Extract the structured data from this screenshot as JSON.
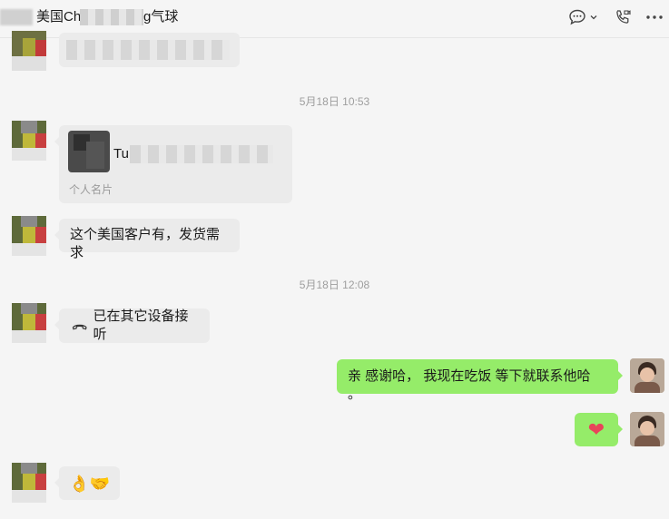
{
  "header": {
    "title_prefix": "美国Chri",
    "title_suffix": "g气球",
    "icons": [
      "chat-dropdown-icon",
      "call-icon",
      "more-icon"
    ]
  },
  "messages": {
    "ts1": "5月18日 10:53",
    "card_name": "Tu",
    "card_label": "个人名片",
    "msg_text1": "这个美国客户有，发货需求",
    "ts2": "5月18日 12:08",
    "call_text": "已在其它设备接听",
    "my_msg1": "亲 感谢哈， 我现在吃饭 等下就联系他哈 。",
    "my_emoji": "❤",
    "their_emoji": "👌🤝"
  },
  "colors": {
    "my_bubble": "#95ec69",
    "their_bubble": "#ebebeb",
    "background": "#f5f5f5"
  }
}
